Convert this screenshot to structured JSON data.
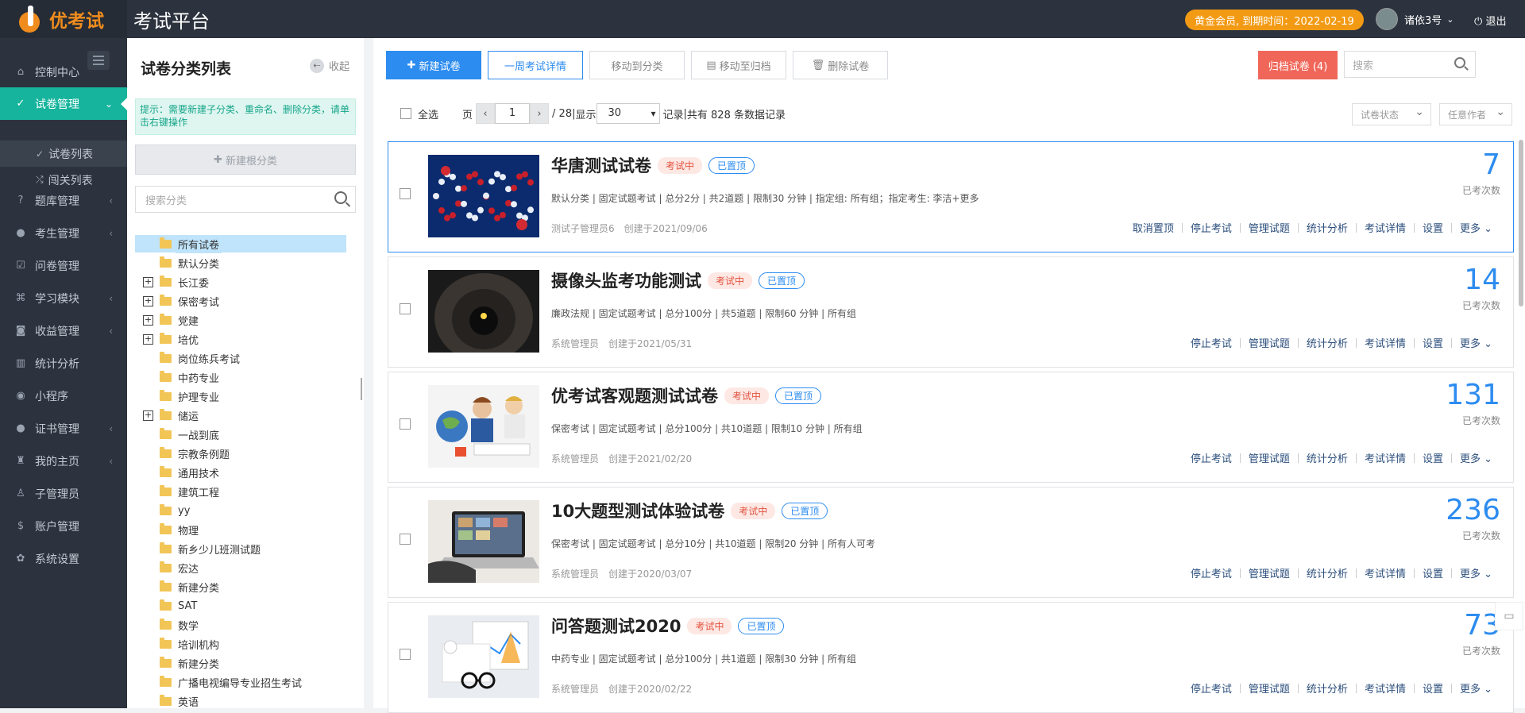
{
  "header": {
    "logo_text": "优考试",
    "platform": "考试平台",
    "vip": "黄金会员, 到期时间：2022-02-19",
    "user": "诸依3号",
    "logout": "退出"
  },
  "sidebar": {
    "items": [
      {
        "label": "控制中心",
        "icon": "home-icon",
        "glyph": "⌂",
        "arrow": ""
      },
      {
        "label": "试卷管理",
        "icon": "check-circle-icon",
        "glyph": "✓",
        "arrow": "⌄"
      },
      {
        "label": "题库管理",
        "icon": "question-icon",
        "glyph": "?",
        "arrow": "‹"
      },
      {
        "label": "考生管理",
        "icon": "user-icon",
        "glyph": "●",
        "arrow": "‹"
      },
      {
        "label": "问卷管理",
        "icon": "checkbox-icon",
        "glyph": "☑",
        "arrow": ""
      },
      {
        "label": "学习模块",
        "icon": "graduation-icon",
        "glyph": "⌘",
        "arrow": "‹"
      },
      {
        "label": "收益管理",
        "icon": "money-icon",
        "glyph": "◙",
        "arrow": "‹"
      },
      {
        "label": "统计分析",
        "icon": "chart-icon",
        "glyph": "▥",
        "arrow": ""
      },
      {
        "label": "小程序",
        "icon": "wechat-icon",
        "glyph": "◉",
        "arrow": ""
      },
      {
        "label": "证书管理",
        "icon": "certificate-icon",
        "glyph": "●",
        "arrow": "‹"
      },
      {
        "label": "我的主页",
        "icon": "home-user-icon",
        "glyph": "♜",
        "arrow": "‹"
      },
      {
        "label": "子管理员",
        "icon": "sub-admin-icon",
        "glyph": "♙",
        "arrow": ""
      },
      {
        "label": "账户管理",
        "icon": "dollar-icon",
        "glyph": "$",
        "arrow": ""
      },
      {
        "label": "系统设置",
        "icon": "gear-icon",
        "glyph": "✿",
        "arrow": ""
      }
    ],
    "subitems": [
      {
        "label": "试卷列表",
        "glyph": "✓"
      },
      {
        "label": "闯关列表",
        "glyph": "⤭"
      }
    ]
  },
  "panel": {
    "title": "试卷分类列表",
    "collapse": "收起",
    "tip": "提示：需要新建子分类、重命名、删除分类，请单击右键操作",
    "new_root": "新建根分类",
    "search_placeholder": "搜索分类"
  },
  "tree": [
    {
      "label": "所有试卷",
      "box": false,
      "sel": true
    },
    {
      "label": "默认分类",
      "box": false
    },
    {
      "label": "长江委",
      "box": true
    },
    {
      "label": "保密考试",
      "box": true
    },
    {
      "label": "党建",
      "box": true
    },
    {
      "label": "培优",
      "box": true
    },
    {
      "label": "岗位练兵考试",
      "box": false
    },
    {
      "label": "中药专业",
      "box": false
    },
    {
      "label": "护理专业",
      "box": false
    },
    {
      "label": "储运",
      "box": true
    },
    {
      "label": "一战到底",
      "box": false
    },
    {
      "label": "宗教条例题",
      "box": false
    },
    {
      "label": "通用技术",
      "box": false
    },
    {
      "label": "建筑工程",
      "box": false
    },
    {
      "label": "yy",
      "box": false
    },
    {
      "label": "物理",
      "box": false
    },
    {
      "label": "新乡少儿班测试题",
      "box": false
    },
    {
      "label": "宏达",
      "box": false
    },
    {
      "label": "新建分类",
      "box": false
    },
    {
      "label": "SAT",
      "box": false
    },
    {
      "label": "数学",
      "box": false
    },
    {
      "label": "培训机构",
      "box": false
    },
    {
      "label": "新建分类",
      "box": false
    },
    {
      "label": "广播电视编导专业招生考试",
      "box": false
    },
    {
      "label": "英语",
      "box": false
    }
  ],
  "toolbar": {
    "new_exam": "新建试卷",
    "week_detail": "一周考试详情",
    "move_category": "移动到分类",
    "move_archive": "移动至归档",
    "delete": "删除试卷",
    "archived": "归档试卷 (4)",
    "search_placeholder": "搜索"
  },
  "pager": {
    "select_all": "全选",
    "page_label": "页",
    "page": "1",
    "total_pages": "/ 28",
    "show": "显示",
    "page_size": "30",
    "records": "记录",
    "total": "共有 828 条数据记录",
    "filter_status": "试卷状态",
    "filter_author": "任意作者"
  },
  "exams": [
    {
      "title": "华唐测试试卷",
      "status": "考试中",
      "pinned": "已置顶",
      "meta": "默认分类 | 固定试题考试 | 总分2分 | 共2道题 | 限制30 分钟 | 指定组: 所有组；指定考生: 李洁+更多",
      "author": "测试子管理员6",
      "created": "创建于2021/09/06",
      "count": "7",
      "count_label": "已考次数",
      "actions": [
        "取消置顶",
        "停止考试",
        "管理试题",
        "统计分析",
        "考试详情",
        "设置",
        "更多 ⌄"
      ]
    },
    {
      "title": "摄像头监考功能测试",
      "status": "考试中",
      "pinned": "已置顶",
      "meta": "廉政法规 | 固定试题考试 | 总分100分 | 共5道题 | 限制60 分钟 | 所有组",
      "author": "系统管理员",
      "created": "创建于2021/05/31",
      "count": "14",
      "count_label": "已考次数",
      "actions": [
        "停止考试",
        "管理试题",
        "统计分析",
        "考试详情",
        "设置",
        "更多 ⌄"
      ]
    },
    {
      "title": "优考试客观题测试试卷",
      "status": "考试中",
      "pinned": "已置顶",
      "meta": "保密考试 | 固定试题考试 | 总分100分 | 共10道题 | 限制10 分钟 | 所有组",
      "author": "系统管理员",
      "created": "创建于2021/02/20",
      "count": "131",
      "count_label": "已考次数",
      "actions": [
        "停止考试",
        "管理试题",
        "统计分析",
        "考试详情",
        "设置",
        "更多 ⌄"
      ]
    },
    {
      "title": "10大题型测试体验试卷",
      "status": "考试中",
      "pinned": "已置顶",
      "meta": "保密考试 | 固定试题考试 | 总分10分 | 共10道题 | 限制20 分钟 | 所有人可考",
      "author": "系统管理员",
      "created": "创建于2020/03/07",
      "count": "236",
      "count_label": "已考次数",
      "actions": [
        "停止考试",
        "管理试题",
        "统计分析",
        "考试详情",
        "设置",
        "更多 ⌄"
      ]
    },
    {
      "title": "问答题测试2020",
      "status": "考试中",
      "pinned": "已置顶",
      "meta": "中药专业 | 固定试题考试 | 总分100分 | 共1道题 | 限制30 分钟 | 所有组",
      "author": "系统管理员",
      "created": "创建于2020/02/22",
      "count": "73",
      "count_label": "已考次数",
      "actions": [
        "停止考试",
        "管理试题",
        "统计分析",
        "考试详情",
        "设置",
        "更多 ⌄"
      ]
    }
  ]
}
